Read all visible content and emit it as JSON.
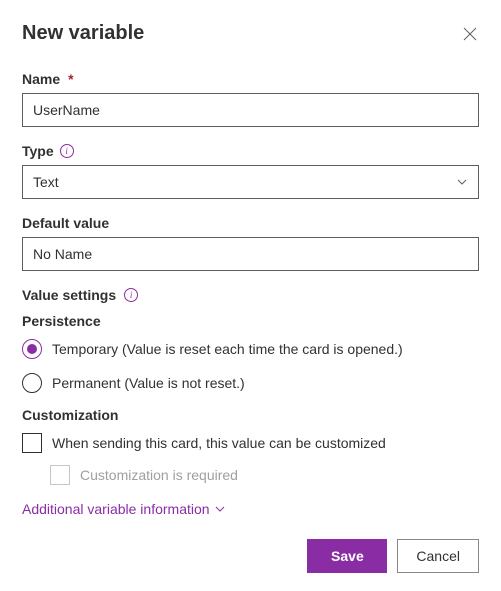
{
  "dialog": {
    "title": "New variable"
  },
  "fields": {
    "name": {
      "label": "Name",
      "value": "UserName"
    },
    "type": {
      "label": "Type",
      "value": "Text"
    },
    "defaultValue": {
      "label": "Default value",
      "value": "No Name"
    }
  },
  "valueSettings": {
    "label": "Value settings",
    "persistence": {
      "label": "Persistence",
      "temporary": "Temporary (Value is reset each time the card is opened.)",
      "permanent": "Permanent (Value is not reset.)"
    },
    "customization": {
      "label": "Customization",
      "sendable": "When sending this card, this value can be customized",
      "required": "Customization is required"
    }
  },
  "additional": {
    "label": "Additional variable information"
  },
  "buttons": {
    "save": "Save",
    "cancel": "Cancel"
  }
}
